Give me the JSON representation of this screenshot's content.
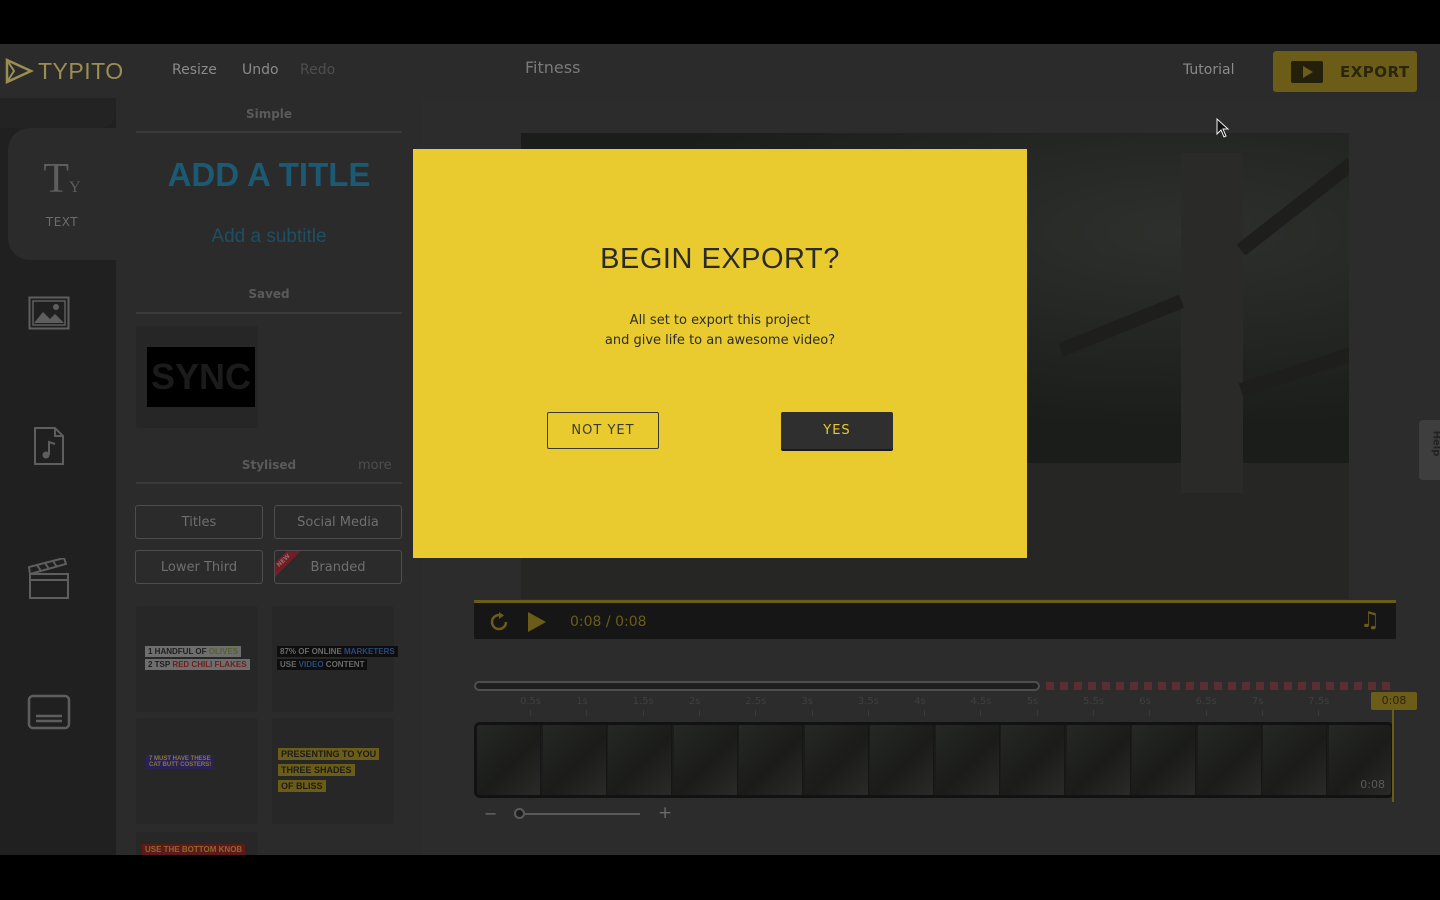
{
  "app": {
    "logo_text": "TYPITO",
    "project_title": "Fitness"
  },
  "toolbar": {
    "resize_label": "Resize",
    "undo_label": "Undo",
    "redo_label": "Redo",
    "tutorial_label": "Tutorial",
    "export_label": "EXPORT"
  },
  "rail": {
    "text_label": "TEXT",
    "icons": [
      "text-icon",
      "image-icon",
      "music-icon",
      "clapperboard-icon",
      "subtitles-icon"
    ]
  },
  "panel": {
    "simple_label": "Simple",
    "add_title": "ADD A TITLE",
    "add_subtitle": "Add a subtitle",
    "saved_label": "Saved",
    "saved_item": "SYNC",
    "stylised_label": "Stylised",
    "more_label": "more",
    "categories": [
      "Titles",
      "Social Media",
      "Lower Third",
      "Branded"
    ],
    "new_badge": "NEW",
    "templates": [
      {
        "line1a": "1 HANDFUL OF ",
        "line1b": "OLIVES",
        "line2a": "2 TSP ",
        "line2b": "RED CHILI FLAKES"
      },
      {
        "line1a": "87% OF ONLINE ",
        "line1b": "MARKETERS",
        "line2a": "USE ",
        "line2b": "VIDEO",
        "line2c": " CONTENT"
      },
      {
        "line1": "7 MUST HAVE THESE",
        "line2": "CAT BUTT COSTERS!"
      },
      {
        "line1": "PRESENTING TO YOU",
        "line2": "THREE SHADES",
        "line3": "OF BLISS"
      },
      {
        "line1": "USE THE BOTTOM KNOB"
      }
    ]
  },
  "player": {
    "current_time": "0:08",
    "separator": "/",
    "duration": "0:08"
  },
  "timeline": {
    "ticks": [
      "0.5s",
      "1s",
      "1.5s",
      "2s",
      "2.5s",
      "3s",
      "3.5s",
      "4s",
      "4.5s",
      "5s",
      "5.5s",
      "6s",
      "6.5s",
      "7s",
      "7.5s"
    ],
    "playhead_label": "0:08",
    "end_label": "0:08"
  },
  "help_tab": "Help",
  "modal": {
    "title": "BEGIN EXPORT?",
    "message_line1": "All set to export this project",
    "message_line2": "and give life to an awesome video?",
    "not_yet_label": "NOT YET",
    "yes_label": "YES"
  },
  "colors": {
    "accent": "#e9cb2f",
    "modal_button_dark": "#2f2f2f"
  }
}
